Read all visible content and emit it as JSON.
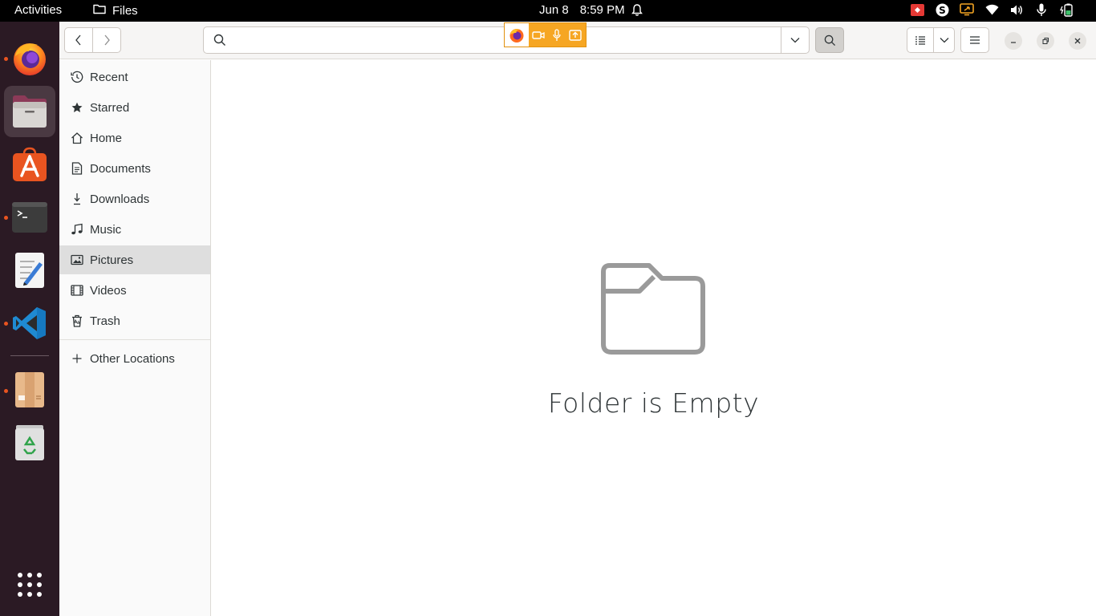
{
  "topbar": {
    "activities": "Activities",
    "app_name": "Files",
    "date": "Jun 8",
    "time": "8:59 PM"
  },
  "dock": {
    "items": [
      {
        "name": "firefox",
        "running": true
      },
      {
        "name": "files",
        "running": true,
        "active": true
      },
      {
        "name": "ubuntu-software",
        "running": false
      },
      {
        "name": "terminal",
        "running": true
      },
      {
        "name": "text-editor",
        "running": false
      },
      {
        "name": "vscode",
        "running": true
      },
      {
        "name": "archive-manager",
        "running": true
      },
      {
        "name": "trash",
        "running": false
      }
    ]
  },
  "search": {
    "placeholder": "",
    "value": ""
  },
  "sidebar": {
    "items": [
      {
        "label": "Recent",
        "icon": "clock-icon"
      },
      {
        "label": "Starred",
        "icon": "star-icon"
      },
      {
        "label": "Home",
        "icon": "home-icon"
      },
      {
        "label": "Documents",
        "icon": "document-icon"
      },
      {
        "label": "Downloads",
        "icon": "download-icon"
      },
      {
        "label": "Music",
        "icon": "music-icon"
      },
      {
        "label": "Pictures",
        "icon": "picture-icon",
        "selected": true
      },
      {
        "label": "Videos",
        "icon": "video-icon"
      },
      {
        "label": "Trash",
        "icon": "trash-icon"
      }
    ],
    "other_locations": "Other Locations"
  },
  "main": {
    "empty_message": "Folder is Empty"
  },
  "colors": {
    "accent": "#e95420",
    "share_indicator": "#f6a623",
    "dock_bg": "#2b1a24"
  }
}
